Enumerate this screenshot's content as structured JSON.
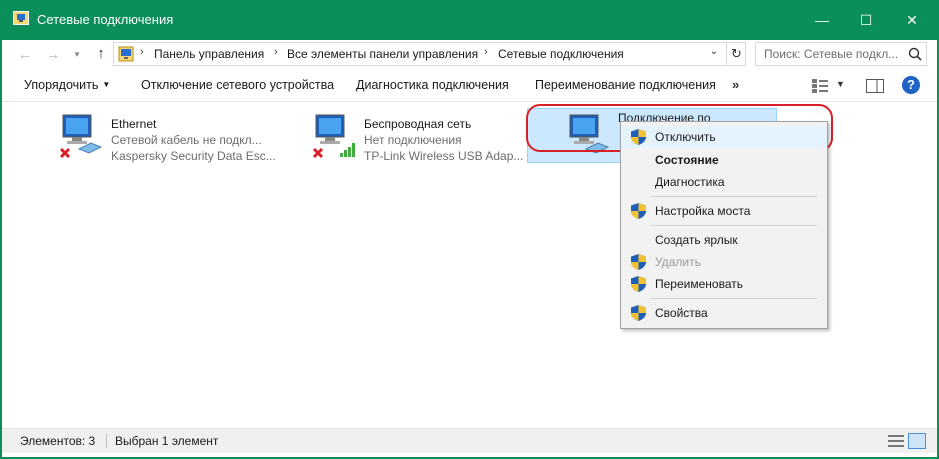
{
  "window": {
    "title": "Сетевые подключения",
    "accent_color": "#0a8f5a",
    "minimize_glyph": "—",
    "maximize_glyph": "☐",
    "close_glyph": "✕"
  },
  "address_bar": {
    "breadcrumbs": [
      "Панель управления",
      "Все элементы панели управления",
      "Сетевые подключения"
    ],
    "search_placeholder": "Поиск: Сетевые подкл..."
  },
  "toolbar": {
    "organize_label": "Упорядочить",
    "disable_device_label": "Отключение сетевого устройства",
    "diagnose_label": "Диагностика подключения",
    "rename_label": "Переименование подключения",
    "more_label": "»",
    "help_label": "?"
  },
  "connections": [
    {
      "name": "Ethernet",
      "status": "Сетевой кабель не подкл...",
      "adapter": "Kaspersky Security Data Esc...",
      "icon": "ethernet-disconnected-icon"
    },
    {
      "name": "Беспроводная сеть",
      "status": "Нет подключения",
      "adapter": "TP-Link Wireless USB Adap...",
      "icon": "wireless-disconnected-icon"
    },
    {
      "name": "Подключение по",
      "status": "",
      "adapter": "",
      "icon": "network-connection-icon",
      "selected": true
    }
  ],
  "context_menu": {
    "items": [
      {
        "label": "Отключить",
        "shield": true,
        "highlighted": true
      },
      {
        "label": "Состояние",
        "bold": true
      },
      {
        "label": "Диагностика"
      },
      {
        "label": "Настройка моста",
        "shield": true
      },
      {
        "label": "Создать ярлык"
      },
      {
        "label": "Удалить",
        "shield": true,
        "disabled": true
      },
      {
        "label": "Переименовать",
        "shield": true
      },
      {
        "label": "Свойства",
        "shield": true
      }
    ]
  },
  "status_bar": {
    "items_count": "Элементов: 3",
    "selected_count": "Выбран 1 элемент"
  },
  "highlight_color": "#d9202a"
}
